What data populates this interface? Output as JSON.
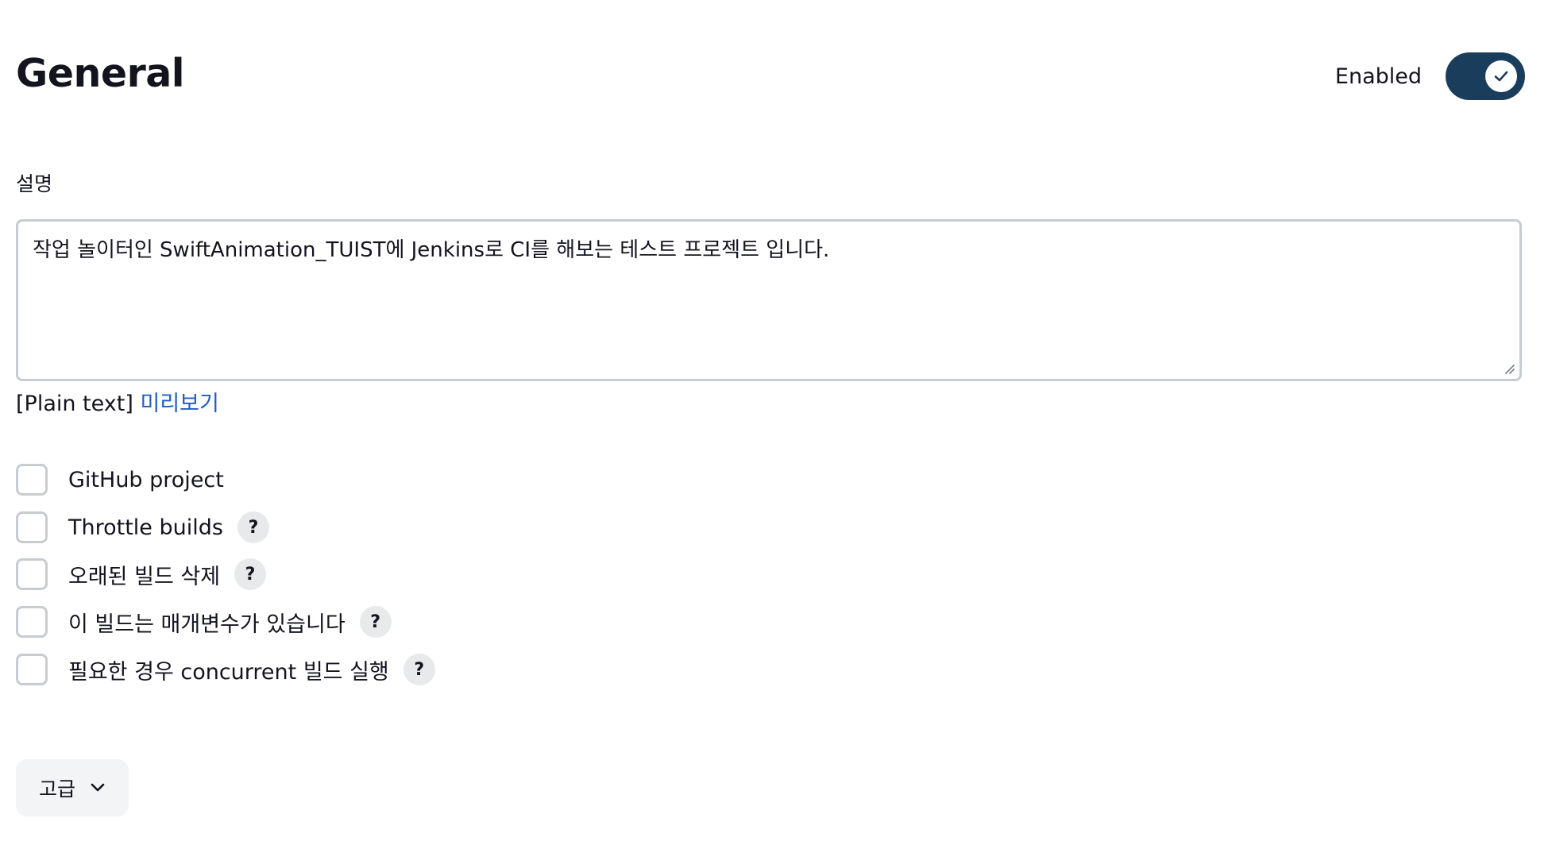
{
  "header": {
    "title": "General",
    "enabled_label": "Enabled",
    "enabled": true
  },
  "description": {
    "label": "설명",
    "value": "작업 놀이터인 SwiftAnimation_TUIST에 Jenkins로 CI를 해보는 테스트 프로젝트 입니다.",
    "format_label": "[Plain text]",
    "preview_link": "미리보기"
  },
  "options": [
    {
      "label": "GitHub project",
      "checked": false,
      "help": false
    },
    {
      "label": "Throttle builds",
      "checked": false,
      "help": true
    },
    {
      "label": "오래된 빌드 삭제",
      "checked": false,
      "help": true
    },
    {
      "label": "이 빌드는 매개변수가 있습니다",
      "checked": false,
      "help": true
    },
    {
      "label": "필요한 경우 concurrent 빌드 실행",
      "checked": false,
      "help": true
    }
  ],
  "help_symbol": "?",
  "advanced": {
    "label": "고급",
    "icon": "chevron-down-icon"
  },
  "colors": {
    "toggle_on": "#1a3d5c",
    "link": "#1f5fbf",
    "border": "#c7ccd1"
  }
}
